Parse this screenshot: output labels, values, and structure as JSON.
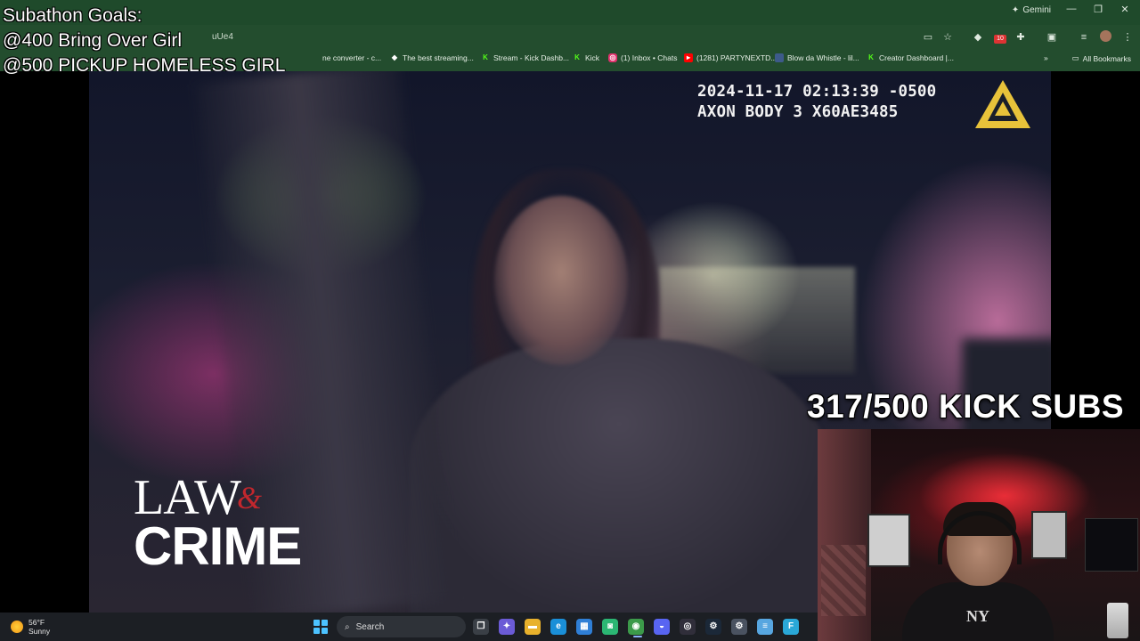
{
  "overlay": {
    "goals_title": "Subathon Goals:",
    "goal_1": "@400 Bring Over Girl",
    "goal_2": "@500 PICKUP HOMELESS GIRL",
    "sub_counter": "317/500 KICK SUBS"
  },
  "browser": {
    "gemini_label": "Gemini",
    "url_fragment": "uUe4",
    "extensions_badge": "10",
    "bookmarks": [
      {
        "label": "ne converter - c...",
        "icon": "converter-icon",
        "color": "#7a8a7a"
      },
      {
        "label": "The best streaming...",
        "icon": "diamond-icon",
        "color": "#ffffff"
      },
      {
        "label": "Stream - Kick Dashb...",
        "icon": "kick-icon",
        "color": "#53fc18"
      },
      {
        "label": "Kick",
        "icon": "kick-icon",
        "color": "#53fc18"
      },
      {
        "label": "(1) Inbox • Chats",
        "icon": "instagram-icon",
        "color": "#e1306c"
      },
      {
        "label": "(1281) PARTYNEXTD...",
        "icon": "youtube-icon",
        "color": "#ff0000"
      },
      {
        "label": "Blow da Whistle - lil...",
        "icon": "page-icon",
        "color": "#3d5a8a"
      },
      {
        "label": "Creator Dashboard |...",
        "icon": "kick-icon",
        "color": "#53fc18"
      }
    ],
    "all_bookmarks_label": "All Bookmarks"
  },
  "video": {
    "timestamp": "2024-11-17 02:13:39 -0500",
    "device": "AXON BODY 3 X60AE3485",
    "logo_law": "LAW",
    "logo_amp": "&",
    "logo_crime": "CRIME"
  },
  "taskbar": {
    "temperature": "56°F",
    "condition": "Sunny",
    "search_placeholder": "Search",
    "icons": [
      {
        "name": "task-view-icon",
        "glyph": "❐",
        "color": "#3a3f46"
      },
      {
        "name": "copilot-icon",
        "glyph": "✦",
        "color": "#6b5bd6"
      },
      {
        "name": "file-explorer-icon",
        "glyph": "▬",
        "color": "#e8b12c"
      },
      {
        "name": "edge-icon",
        "glyph": "e",
        "color": "#1a8fd8"
      },
      {
        "name": "store-icon",
        "glyph": "▦",
        "color": "#2f7fd6"
      },
      {
        "name": "xbox-icon",
        "glyph": "◙",
        "color": "#2bb673"
      },
      {
        "name": "chrome-icon",
        "glyph": "◉",
        "color": "#3c9a4a"
      },
      {
        "name": "discord-icon",
        "glyph": "◒",
        "color": "#5865f2"
      },
      {
        "name": "obs-icon",
        "glyph": "◎",
        "color": "#302e3a"
      },
      {
        "name": "steam-icon",
        "glyph": "⚙",
        "color": "#1b2838"
      },
      {
        "name": "settings-icon",
        "glyph": "⚙",
        "color": "#4a5260"
      },
      {
        "name": "notepad-icon",
        "glyph": "≡",
        "color": "#57a6e0"
      },
      {
        "name": "app-f-icon",
        "glyph": "F",
        "color": "#2aa8d8"
      }
    ]
  }
}
